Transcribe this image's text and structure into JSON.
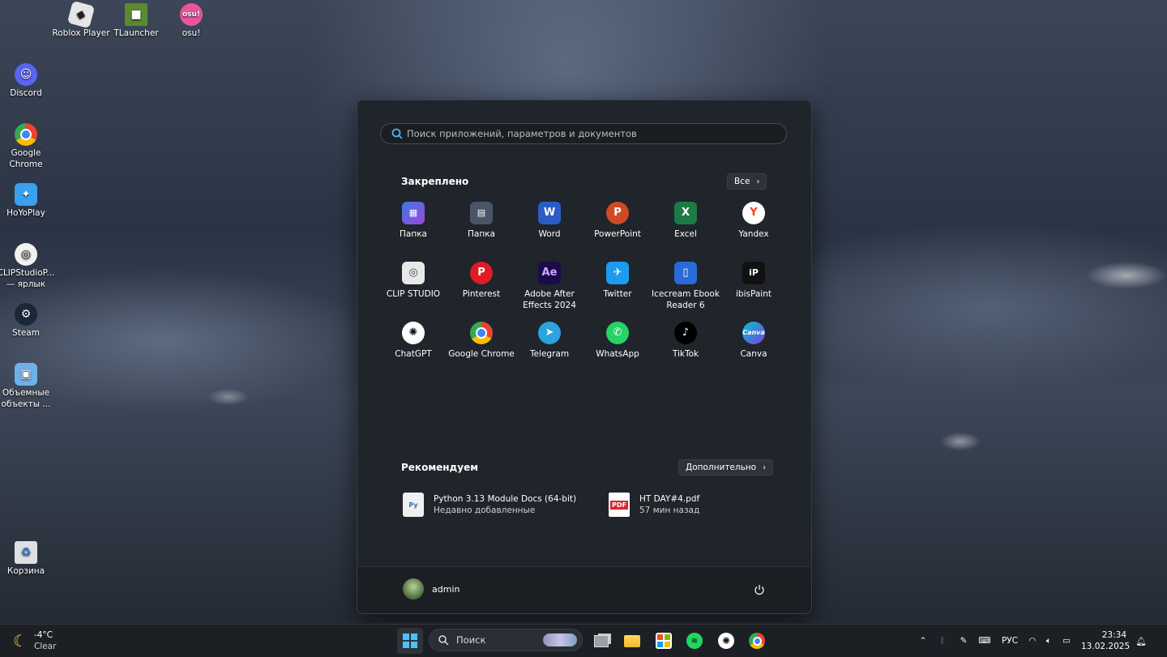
{
  "desktop": {
    "icons": [
      {
        "label": "Roblox Player",
        "icon": "roblox-icon"
      },
      {
        "label": "TLauncher",
        "icon": "tlauncher-icon"
      },
      {
        "label": "osu!",
        "icon": "osu-icon"
      },
      {
        "label": "Discord",
        "icon": "discord-icon"
      },
      {
        "label": "Google Chrome",
        "icon": "chrome-icon"
      },
      {
        "label": "HoYoPlay",
        "icon": "hoyoplay-icon"
      },
      {
        "label": "CLIPStudioP... — ярлык",
        "icon": "clip-studio-icon"
      },
      {
        "label": "Steam",
        "icon": "steam-icon"
      },
      {
        "label": "Объемные объекты ...",
        "icon": "3d-objects-icon"
      },
      {
        "label": "Корзина",
        "icon": "recycle-bin-icon"
      }
    ]
  },
  "start_menu": {
    "search_placeholder": "Поиск приложений, параметров и документов",
    "pinned_title": "Закреплено",
    "all_button": "Все",
    "pinned": [
      {
        "label": "Папка",
        "icon": "folder-apps-icon",
        "color": "#3a6fd8"
      },
      {
        "label": "Папка",
        "icon": "folder-tools-icon",
        "color": "#4a5568"
      },
      {
        "label": "Word",
        "icon": "word-icon",
        "color": "#2b5cc8"
      },
      {
        "label": "PowerPoint",
        "icon": "powerpoint-icon",
        "color": "#d04a25"
      },
      {
        "label": "Excel",
        "icon": "excel-icon",
        "color": "#1e7a45"
      },
      {
        "label": "Yandex",
        "icon": "yandex-icon",
        "color": "#ffffff"
      },
      {
        "label": "CLIP STUDIO",
        "icon": "clip-studio-icon",
        "color": "#e8e8e8"
      },
      {
        "label": "Pinterest",
        "icon": "pinterest-icon",
        "color": "#e01b24"
      },
      {
        "label": "Adobe After Effects 2024",
        "icon": "after-effects-icon",
        "color": "#1a0b4a"
      },
      {
        "label": "Twitter",
        "icon": "twitter-icon",
        "color": "#1d9bf0"
      },
      {
        "label": "Icecream Ebook Reader 6",
        "icon": "ebook-reader-icon",
        "color": "#2a6ad8"
      },
      {
        "label": "ibisPaint",
        "icon": "ibispaint-icon",
        "color": "#111111"
      },
      {
        "label": "ChatGPT",
        "icon": "chatgpt-icon",
        "color": "#ffffff"
      },
      {
        "label": "Google Chrome",
        "icon": "chrome-icon",
        "color": "#e8e8e8"
      },
      {
        "label": "Telegram",
        "icon": "telegram-icon",
        "color": "#2aa3df"
      },
      {
        "label": "WhatsApp",
        "icon": "whatsapp-icon",
        "color": "#25d366"
      },
      {
        "label": "TikTok",
        "icon": "tiktok-icon",
        "color": "#000000"
      },
      {
        "label": "Canva",
        "icon": "canva-icon",
        "color": "#7d3ee0"
      }
    ],
    "recommended_title": "Рекомендуем",
    "more_button": "Дополнительно",
    "recommended": [
      {
        "title": "Python 3.13 Module Docs (64-bit)",
        "sub": "Недавно добавленные",
        "icon": "python-docs-icon"
      },
      {
        "title": "HT DAY#4.pdf",
        "sub": "57 мин назад",
        "icon": "pdf-icon"
      }
    ],
    "user": "admin"
  },
  "taskbar": {
    "weather_temp": "-4°C",
    "weather_desc": "Clear",
    "search_label": "Поиск",
    "language": "РУС",
    "time": "23:34",
    "date": "13.02.2025"
  }
}
